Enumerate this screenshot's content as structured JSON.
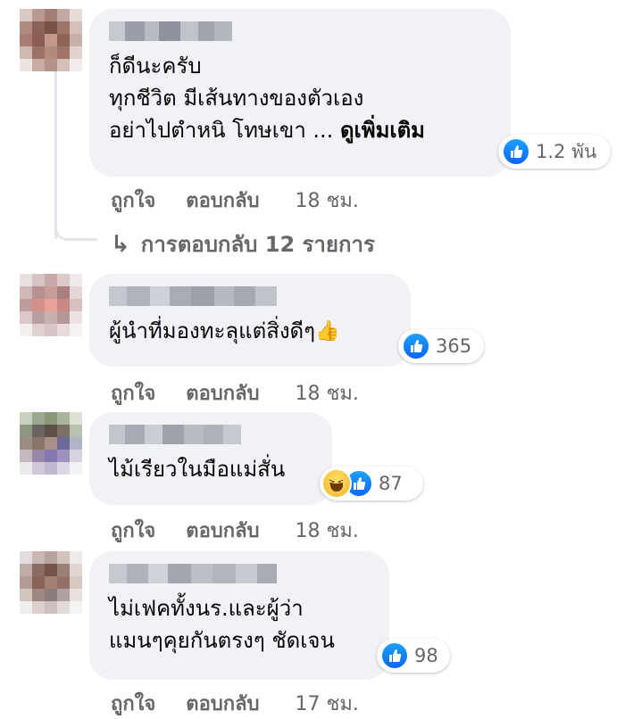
{
  "comments": [
    {
      "text": "ก็ดีนะครับ\nทุกชีวิต มีเส้นทางของตัวเอง\nอย่าไปตำหนิ โทษเขา ...",
      "see_more": "ดูเพิ่มเติม",
      "reaction_count": "1.2 พัน",
      "like_label": "ถูกใจ",
      "reply_label": "ตอบกลับ",
      "time": "18 ชม.",
      "replies_label": "การตอบกลับ 12 รายการ"
    },
    {
      "text": "ผู้นำที่มองทะลุแต่สิ่งดีๆ",
      "emoji": "👍",
      "reaction_count": "365",
      "like_label": "ถูกใจ",
      "reply_label": "ตอบกลับ",
      "time": "18 ชม."
    },
    {
      "text": "ไม้เรียวในมือแม่สั่น",
      "reaction_count": "87",
      "like_label": "ถูกใจ",
      "reply_label": "ตอบกลับ",
      "time": "18 ชม."
    },
    {
      "text": "ไม่เฟคทั้งนร.และผู้ว่า\nแมนๆคุยกันตรงๆ ชัดเจน",
      "reaction_count": "98",
      "like_label": "ถูกใจ",
      "reply_label": "ตอบกลับ",
      "time": "17 ชม."
    }
  ],
  "icons": {
    "like": "like-icon",
    "haha": "haha-icon",
    "reply_arrow": "reply-arrow-icon"
  },
  "colors": {
    "like_blue": "#0866ff",
    "bubble_bg": "#f0f2f5",
    "meta_text": "#65676b"
  }
}
